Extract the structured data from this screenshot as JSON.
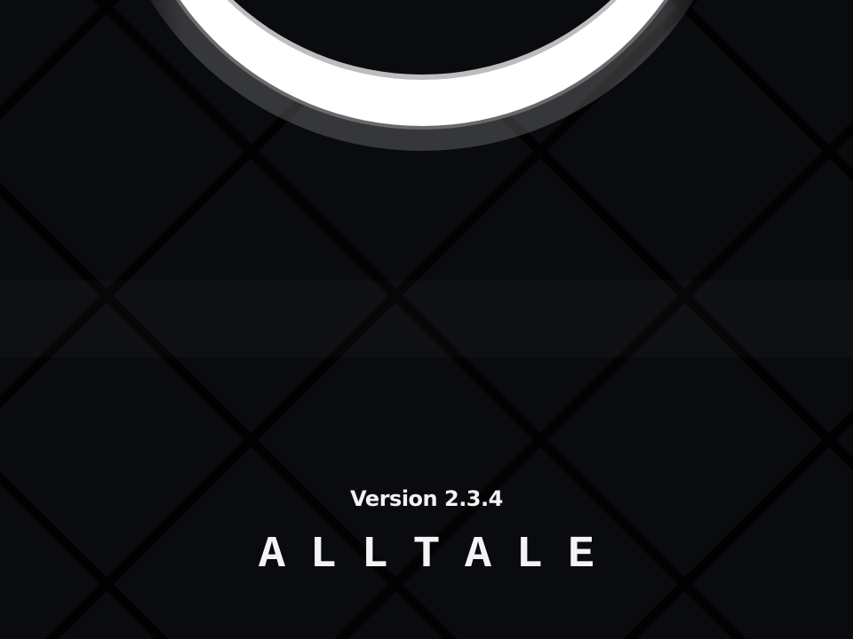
{
  "version_text": "Version 2.3.4",
  "title_text": "ALLTALE",
  "colors": {
    "background": "#0a0b0f",
    "grid_line": "#020203",
    "ring": "#ffffff",
    "text": "#f4f4f4"
  },
  "icons": {
    "ring": "logo-ring-icon"
  }
}
